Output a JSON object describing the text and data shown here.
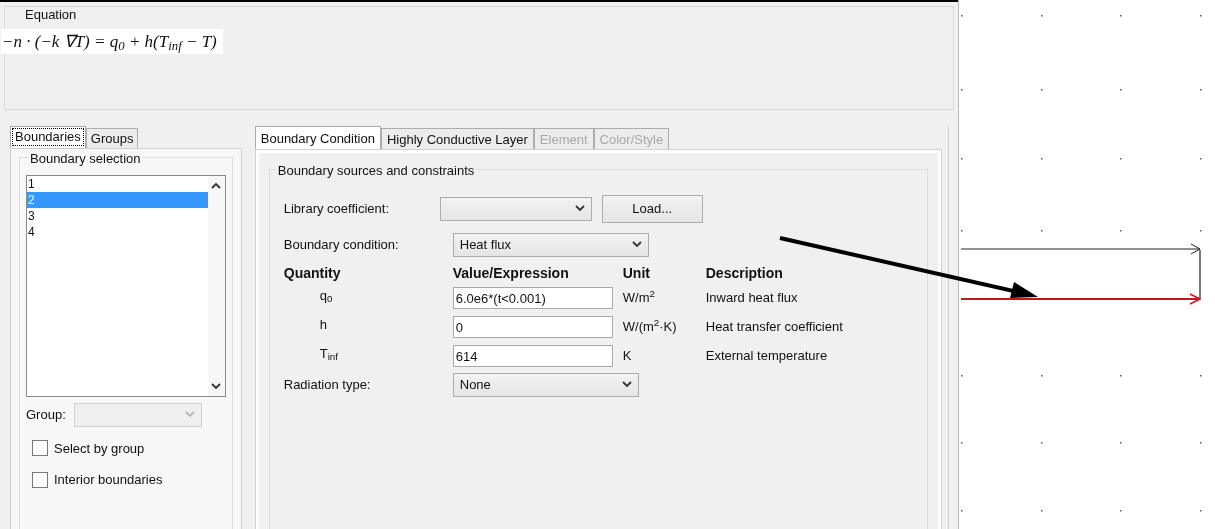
{
  "equation": {
    "label": "Equation",
    "formula": "−n · (−k ∇T) = q$_{0}$ + h(T$_{inf}$ − T)"
  },
  "left_tabs": [
    {
      "label": "Boundaries",
      "selected": true
    },
    {
      "label": "Groups",
      "selected": false
    }
  ],
  "boundary_selection": {
    "title": "Boundary selection",
    "items": [
      {
        "label": "1",
        "selected": false
      },
      {
        "label": "2",
        "selected": true
      },
      {
        "label": "3",
        "selected": false
      },
      {
        "label": "4",
        "selected": false
      }
    ],
    "group_label": "Group:",
    "group_disabled": true,
    "checkboxes": [
      {
        "label": "Select by group",
        "checked": false
      },
      {
        "label": "Interior boundaries",
        "checked": false
      }
    ]
  },
  "right_tabs": [
    {
      "label": "Boundary Condition",
      "selected": true,
      "disabled": false
    },
    {
      "label": "Highly Conductive Layer",
      "selected": false,
      "disabled": false
    },
    {
      "label": "Element",
      "selected": false,
      "disabled": true
    },
    {
      "label": "Color/Style",
      "selected": false,
      "disabled": true
    }
  ],
  "sources": {
    "title": "Boundary sources and constraints",
    "library_label": "Library coefficient:",
    "load_button": "Load...",
    "condition_label": "Boundary condition:",
    "condition_value": "Heat flux",
    "columns": [
      "Quantity",
      "Value/Expression",
      "Unit",
      "Description"
    ],
    "rows": [
      {
        "quantity": "q$_{0}$",
        "value": "6.0e6*(t<0.001)",
        "unit": "W/m$^{2}$",
        "description": "Inward heat flux"
      },
      {
        "quantity": "h",
        "value": "0",
        "unit": "W/(m$^{2}$·K)",
        "description": "Heat transfer coefficient"
      },
      {
        "quantity": "T$_{inf}$",
        "value": "614",
        "unit": "K",
        "description": "External temperature"
      }
    ],
    "radiation_label": "Radiation type:",
    "radiation_value": "None"
  }
}
